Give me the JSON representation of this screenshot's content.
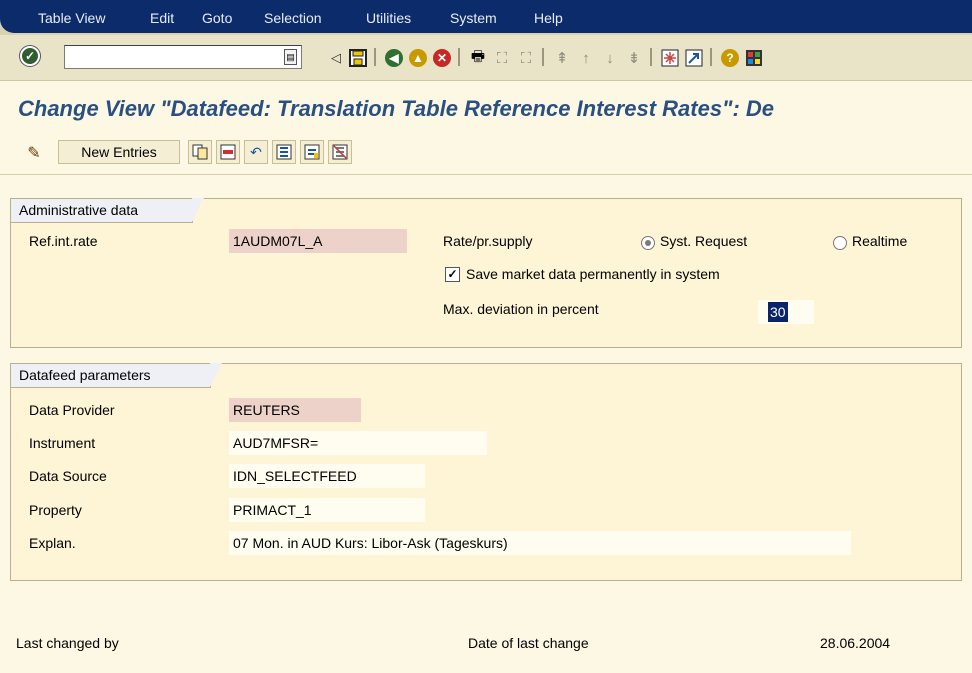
{
  "menu": [
    "Table View",
    "Edit",
    "Goto",
    "Selection",
    "Utilities",
    "System",
    "Help"
  ],
  "command_field": {
    "value": ""
  },
  "toolbar_icons": [
    "enter-icon",
    "back-arrow-icon",
    "save-icon",
    "green-back-icon",
    "exit-icon",
    "cancel-icon",
    "print-icon",
    "find-icon",
    "find-next-icon",
    "first-page-icon",
    "previous-page-icon",
    "next-page-icon",
    "last-page-icon",
    "create-session-icon",
    "shortcut-icon",
    "help-icon",
    "layout-icon"
  ],
  "title": "Change View \"Datafeed: Translation Table Reference Interest Rates\": De",
  "app_toolbar": {
    "new_entries": "New Entries"
  },
  "admin": {
    "tab": "Administrative data",
    "ref_label": "Ref.int.rate",
    "ref_value": "1AUDM07L_A",
    "rate_label": "Rate/pr.supply",
    "radio1": "Syst. Request",
    "radio2": "Realtime",
    "checkbox": "Save market data permanently in system",
    "maxdev_label": "Max. deviation in percent",
    "maxdev_value": "30"
  },
  "datafeed": {
    "tab": "Datafeed parameters",
    "rows": [
      {
        "label": "Data Provider",
        "value": "REUTERS"
      },
      {
        "label": "Instrument",
        "value": "AUD7MFSR="
      },
      {
        "label": "Data Source",
        "value": "IDN_SELECTFEED"
      },
      {
        "label": "Property",
        "value": "PRIMACT_1"
      },
      {
        "label": "Explan.",
        "value": "07 Mon. in AUD Kurs: Libor-Ask (Tageskurs)"
      }
    ]
  },
  "footer": {
    "last_changed_by": "Last changed by",
    "date_label": "Date of last change",
    "date_value": "28.06.2004"
  },
  "colors": {
    "menu_bar": "#0b2b6b",
    "title": "#2a4f82",
    "background": "#fdf8e3"
  }
}
